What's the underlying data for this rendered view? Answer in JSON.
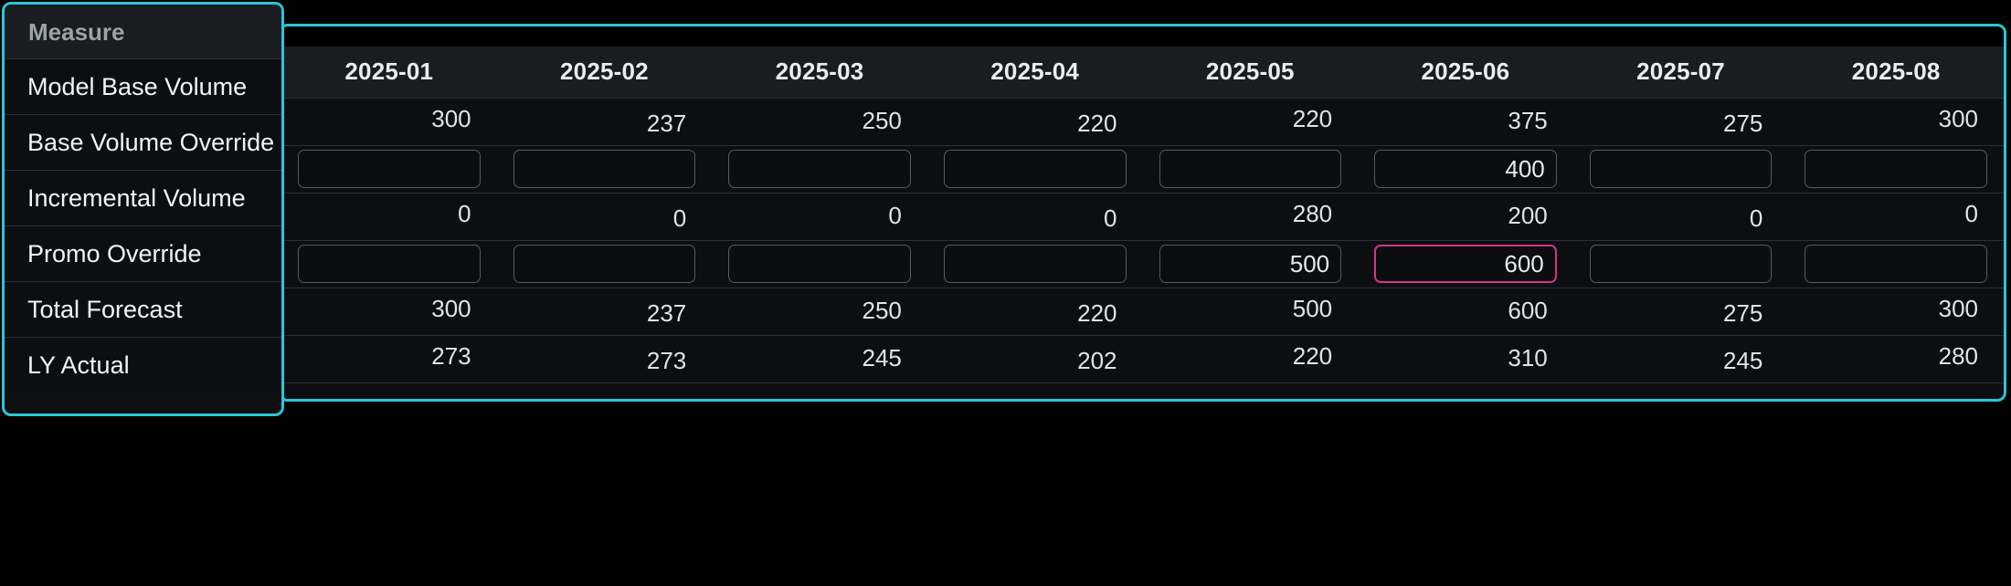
{
  "measure_panel": {
    "header": "Measure",
    "items": [
      {
        "label": "Model Base Volume"
      },
      {
        "label": "Base Volume Override"
      },
      {
        "label": "Incremental Volume"
      },
      {
        "label": "Promo Override"
      },
      {
        "label": "Total Forecast"
      },
      {
        "label": "LY Actual"
      }
    ]
  },
  "colors": {
    "panel_border": "#29c7d6",
    "focus_border": "#d6338c",
    "grid_line": "#2c3136",
    "header_bg": "#191c20",
    "body_bg": "#0c0e11"
  },
  "grid": {
    "columns": [
      "2025-01",
      "2025-02",
      "2025-03",
      "2025-04",
      "2025-05",
      "2025-06",
      "2025-07",
      "2025-08"
    ],
    "rows": [
      {
        "measure": "Model Base Volume",
        "type": "value",
        "values": [
          "300",
          "237",
          "250",
          "220",
          "220",
          "375",
          "275",
          "300"
        ]
      },
      {
        "measure": "Base Volume Override",
        "type": "input",
        "values": [
          "",
          "",
          "",
          "",
          "",
          "400",
          "",
          ""
        ],
        "placeholder": "",
        "focused_index": -1
      },
      {
        "measure": "Incremental Volume",
        "type": "value",
        "values": [
          "0",
          "0",
          "0",
          "0",
          "280",
          "200",
          "0",
          "0"
        ]
      },
      {
        "measure": "Promo Override",
        "type": "input",
        "values": [
          "",
          "",
          "",
          "",
          "500",
          "600",
          "",
          ""
        ],
        "placeholder": "",
        "focused_index": 5
      },
      {
        "measure": "Total Forecast",
        "type": "value",
        "values": [
          "300",
          "237",
          "250",
          "220",
          "500",
          "600",
          "275",
          "300"
        ]
      },
      {
        "measure": "LY Actual",
        "type": "value",
        "values": [
          "273",
          "273",
          "245",
          "202",
          "220",
          "310",
          "245",
          "280"
        ]
      }
    ]
  }
}
